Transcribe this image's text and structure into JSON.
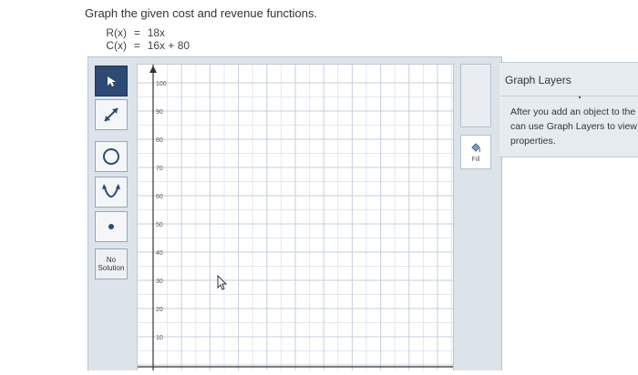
{
  "prompt": "Graph the given cost and revenue functions.",
  "equations": [
    {
      "lhs": "R(x)",
      "op": "=",
      "rhs": "18x"
    },
    {
      "lhs": "C(x)",
      "op": "=",
      "rhs": "16x + 80"
    }
  ],
  "tools": [
    {
      "name": "pointer-tool",
      "icon": "cursor-arrow-icon",
      "active": true
    },
    {
      "name": "line-tool",
      "icon": "line-segment-icon",
      "active": false
    },
    {
      "name": "circle-tool",
      "icon": "circle-icon",
      "active": false
    },
    {
      "name": "parabola-tool",
      "icon": "parabola-icon",
      "active": false
    },
    {
      "name": "point-tool",
      "icon": "point-icon",
      "active": false
    }
  ],
  "no_solution_label": "No Solution",
  "graph": {
    "y_ticks": [
      "100",
      "90",
      "80",
      "70",
      "60",
      "50",
      "40",
      "30",
      "20",
      "10"
    ]
  },
  "fill_label": "Fill",
  "layers": {
    "title": "Graph Layers",
    "text_lines": [
      "After you add an object to the",
      "can use Graph Layers to view",
      "properties."
    ]
  }
}
